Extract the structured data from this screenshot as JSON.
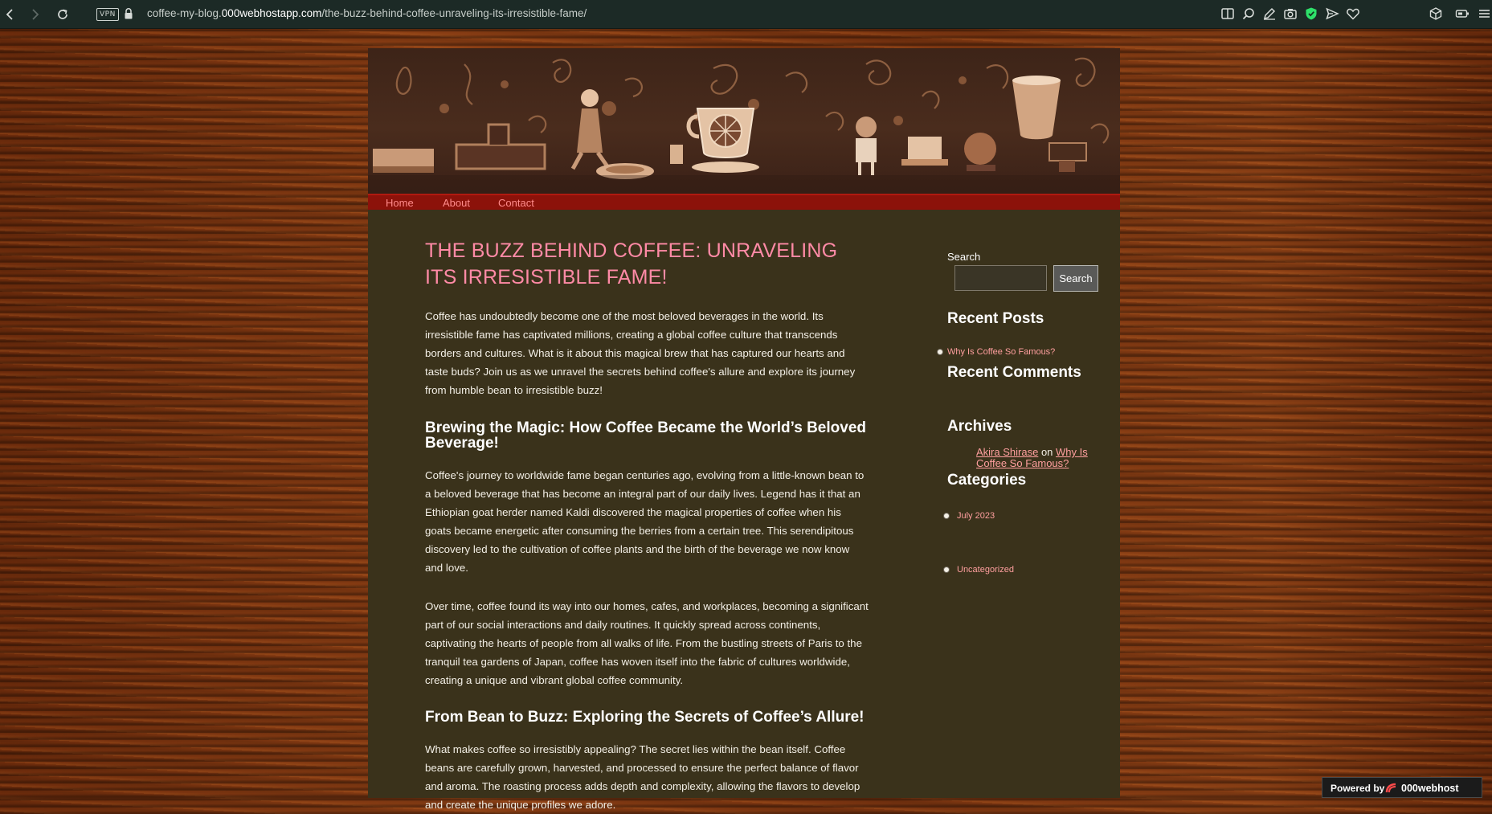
{
  "browser": {
    "url_prefix": "coffee-my-blog.",
    "url_host": "000webhostapp.com",
    "url_path": "/the-buzz-behind-coffee-unraveling-its-irresistible-fame/",
    "vpn_label": "VPN",
    "icons": [
      "back-icon",
      "forward-icon",
      "reload-icon",
      "lock-icon",
      "reader-icon",
      "zoom-icon",
      "edit-icon",
      "camera-icon",
      "shield-icon",
      "send-icon",
      "heart-icon",
      "cube-icon",
      "battery-icon",
      "menu-icon"
    ]
  },
  "nav": {
    "home": "Home",
    "about": "About",
    "contact": "Contact"
  },
  "post": {
    "title": "THE BUZZ BEHIND COFFEE: UNRAVELING ITS IRRESISTIBLE FAME!",
    "intro": "Coffee has undoubtedly become one of the most beloved beverages in the world. Its irresistible fame has captivated millions, creating a global coffee culture that transcends borders and cultures. What is it about this magical brew that has captured our hearts and taste buds? Join us as we unravel the secrets behind coffee's allure and explore its journey from humble bean to irresistible buzz!",
    "heading1": "Brewing the Magic: How Coffee Became the World’s Beloved Beverage!",
    "para1": "Coffee's journey to worldwide fame began centuries ago, evolving from a little-known bean to a beloved beverage that has become an integral part of our daily lives. Legend has it that an Ethiopian goat herder named Kaldi discovered the magical properties of coffee when his goats became energetic after consuming the berries from a certain tree. This serendipitous discovery led to the cultivation of coffee plants and the birth of the beverage we now know and love.",
    "para2": "Over time, coffee found its way into our homes, cafes, and workplaces, becoming a significant part of our social interactions and daily routines. It quickly spread across continents, captivating the hearts of people from all walks of life. From the bustling streets of Paris to the tranquil tea gardens of Japan, coffee has woven itself into the fabric of cultures worldwide, creating a unique and vibrant global coffee community.",
    "heading2": "From Bean to Buzz: Exploring the Secrets of Coffee’s Allure!",
    "para3": "What makes coffee so irresistibly appealing? The secret lies within the bean itself. Coffee beans are carefully grown, harvested, and processed to ensure the perfect balance of flavor and aroma. The roasting process adds depth and complexity, allowing the flavors to develop and create the unique profiles we adore."
  },
  "sidebar": {
    "search_label": "Search",
    "search_value": "",
    "search_button": "Search",
    "recent_posts_title": "Recent Posts",
    "recent_posts": [
      "Why Is Coffee So Famous?"
    ],
    "recent_comments_title": "Recent Comments",
    "comment_author": "Akira Shirase",
    "comment_on": "on",
    "comment_post": "Why Is Coffee So Famous?",
    "archives_title": "Archives",
    "archives": [
      "July 2023"
    ],
    "categories_title": "Categories",
    "categories": [
      "Uncategorized"
    ]
  },
  "footer_badge": {
    "powered_by": "Powered by",
    "brand": "000webhost"
  },
  "colors": {
    "title_pink": "#ff8aa6",
    "link_pink": "#ff9f9f",
    "nav_red": "#8c120a",
    "content_bg": "#3a321b",
    "chrome_bg": "#1c2a26"
  }
}
